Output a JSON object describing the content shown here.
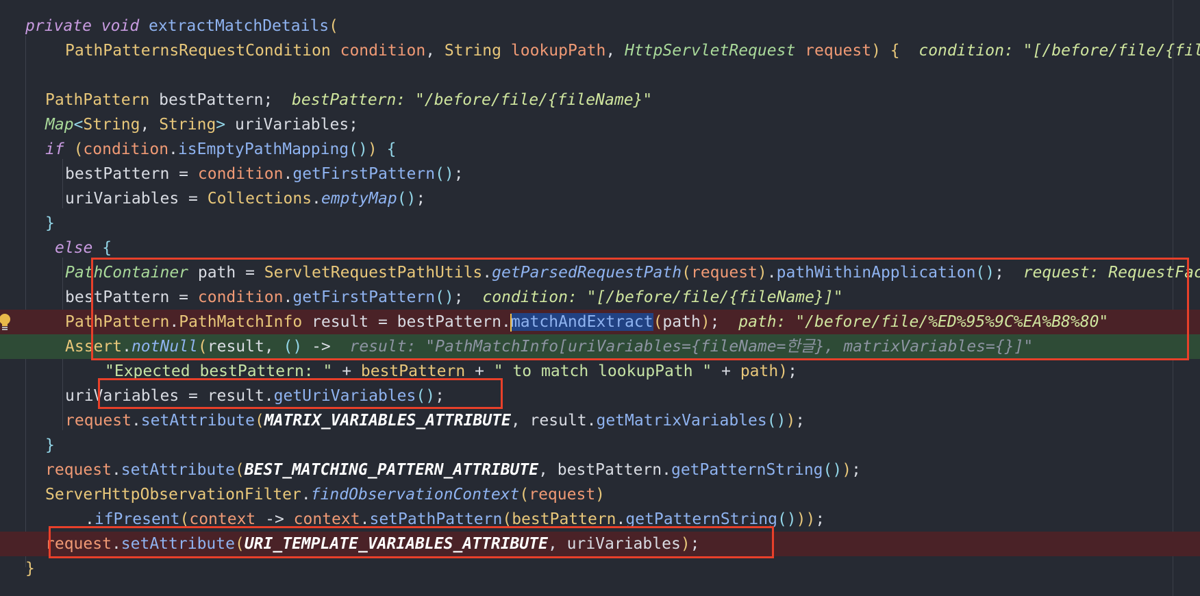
{
  "lines": [
    {
      "id": "method-signature-line",
      "indent": 0,
      "bg": "",
      "tokens": [
        {
          "c": "kw",
          "t": "private"
        },
        {
          "c": "plain",
          "t": " "
        },
        {
          "c": "kw",
          "t": "void"
        },
        {
          "c": "plain",
          "t": " "
        },
        {
          "c": "fn",
          "t": "extractMatchDetails"
        },
        {
          "c": "type",
          "t": "("
        }
      ]
    },
    {
      "id": "method-params-line",
      "indent": 4,
      "bg": "",
      "tokens": [
        {
          "c": "type",
          "t": "PathPatternsRequestCondition"
        },
        {
          "c": "plain",
          "t": " "
        },
        {
          "c": "param",
          "t": "condition"
        },
        {
          "c": "plain",
          "t": ", "
        },
        {
          "c": "type",
          "t": "String"
        },
        {
          "c": "plain",
          "t": " "
        },
        {
          "c": "param",
          "t": "lookupPath"
        },
        {
          "c": "plain",
          "t": ", "
        },
        {
          "c": "type-it",
          "t": "HttpServletRequest"
        },
        {
          "c": "plain",
          "t": " "
        },
        {
          "c": "param",
          "t": "request"
        },
        {
          "c": "type",
          "t": ") {"
        },
        {
          "c": "plain",
          "t": "  "
        },
        {
          "c": "hint",
          "t": "condition: \"[/before/file/{fileName}]\""
        }
      ]
    },
    {
      "id": "blank-line",
      "indent": 0,
      "bg": "",
      "tokens": []
    },
    {
      "id": "best-pattern-decl-line",
      "indent": 2,
      "bg": "",
      "tokens": [
        {
          "c": "type",
          "t": "PathPattern"
        },
        {
          "c": "plain",
          "t": " bestPattern;"
        },
        {
          "c": "plain",
          "t": "  "
        },
        {
          "c": "hint",
          "t": "bestPattern: \"/before/file/{fileName}\""
        }
      ]
    },
    {
      "id": "uri-variables-decl-line",
      "indent": 2,
      "bg": "",
      "tokens": [
        {
          "c": "type-it",
          "t": "Map"
        },
        {
          "c": "punct",
          "t": "<"
        },
        {
          "c": "type",
          "t": "String"
        },
        {
          "c": "plain",
          "t": ", "
        },
        {
          "c": "type",
          "t": "String"
        },
        {
          "c": "punct",
          "t": ">"
        },
        {
          "c": "plain",
          "t": " uriVariables;"
        }
      ]
    },
    {
      "id": "if-line",
      "indent": 2,
      "bg": "",
      "tokens": [
        {
          "c": "kw",
          "t": "if"
        },
        {
          "c": "plain",
          "t": " "
        },
        {
          "c": "type",
          "t": "("
        },
        {
          "c": "param",
          "t": "condition"
        },
        {
          "c": "plain",
          "t": "."
        },
        {
          "c": "fn",
          "t": "isEmptyPathMapping"
        },
        {
          "c": "punct",
          "t": "()"
        },
        {
          "c": "type",
          "t": ")"
        },
        {
          "c": "plain",
          "t": " "
        },
        {
          "c": "punct",
          "t": "{"
        }
      ]
    },
    {
      "id": "if-best-pattern-line",
      "indent": 4,
      "bg": "",
      "tokens": [
        {
          "c": "plain",
          "t": "bestPattern = "
        },
        {
          "c": "param",
          "t": "condition"
        },
        {
          "c": "plain",
          "t": "."
        },
        {
          "c": "fn",
          "t": "getFirstPattern"
        },
        {
          "c": "punct",
          "t": "()"
        },
        {
          "c": "plain",
          "t": ";"
        }
      ]
    },
    {
      "id": "if-uri-variables-line",
      "indent": 4,
      "bg": "",
      "tokens": [
        {
          "c": "plain",
          "t": "uriVariables = "
        },
        {
          "c": "type",
          "t": "Collections"
        },
        {
          "c": "plain",
          "t": "."
        },
        {
          "c": "fn-it",
          "t": "emptyMap"
        },
        {
          "c": "punct",
          "t": "()"
        },
        {
          "c": "plain",
          "t": ";"
        }
      ]
    },
    {
      "id": "if-close-line",
      "indent": 2,
      "bg": "",
      "tokens": [
        {
          "c": "punct",
          "t": "}"
        }
      ]
    },
    {
      "id": "else-line",
      "indent": 2,
      "shift": 14,
      "bg": "",
      "tokens": [
        {
          "c": "kw",
          "t": "else"
        },
        {
          "c": "plain",
          "t": " "
        },
        {
          "c": "punct",
          "t": "{"
        }
      ]
    },
    {
      "id": "path-container-line",
      "indent": 4,
      "bg": "",
      "tokens": [
        {
          "c": "type-it",
          "t": "PathContainer"
        },
        {
          "c": "plain",
          "t": " path = "
        },
        {
          "c": "type",
          "t": "ServletRequestPathUtils"
        },
        {
          "c": "plain",
          "t": "."
        },
        {
          "c": "fn-it",
          "t": "getParsedRequestPath"
        },
        {
          "c": "type",
          "t": "("
        },
        {
          "c": "param",
          "t": "request"
        },
        {
          "c": "type",
          "t": ")"
        },
        {
          "c": "plain",
          "t": "."
        },
        {
          "c": "fn",
          "t": "pathWithinApplication"
        },
        {
          "c": "punct",
          "t": "()"
        },
        {
          "c": "plain",
          "t": ";"
        },
        {
          "c": "plain",
          "t": "  "
        },
        {
          "c": "hint",
          "t": "request: RequestFacade"
        }
      ]
    },
    {
      "id": "else-best-pattern-line",
      "indent": 4,
      "bg": "",
      "tokens": [
        {
          "c": "plain",
          "t": "bestPattern = "
        },
        {
          "c": "param",
          "t": "condition"
        },
        {
          "c": "plain",
          "t": "."
        },
        {
          "c": "fn",
          "t": "getFirstPattern"
        },
        {
          "c": "punct",
          "t": "()"
        },
        {
          "c": "plain",
          "t": ";"
        },
        {
          "c": "plain",
          "t": "  "
        },
        {
          "c": "hint",
          "t": "condition: \"[/before/file/{fileName}]\""
        }
      ]
    },
    {
      "id": "match-and-extract-line",
      "indent": 4,
      "bg": "bp-red",
      "tokens": [
        {
          "c": "type",
          "t": "PathPattern"
        },
        {
          "c": "plain",
          "t": "."
        },
        {
          "c": "type",
          "t": "PathMatchInfo"
        },
        {
          "c": "plain",
          "t": " result = bestPattern."
        },
        {
          "c": "caret",
          "t": ""
        },
        {
          "c": "fn sel",
          "t": "matchAndExtract"
        },
        {
          "c": "type",
          "t": "("
        },
        {
          "c": "plain",
          "t": "path"
        },
        {
          "c": "type",
          "t": ")"
        },
        {
          "c": "plain",
          "t": ";"
        },
        {
          "c": "plain",
          "t": "  "
        },
        {
          "c": "hint",
          "t": "path: \"/before/file/%ED%95%9C%EA%B8%80\""
        }
      ]
    },
    {
      "id": "assert-line",
      "indent": 4,
      "bg": "exec-green",
      "tokens": [
        {
          "c": "type",
          "t": "Assert"
        },
        {
          "c": "plain",
          "t": "."
        },
        {
          "c": "fn-it",
          "t": "notNull"
        },
        {
          "c": "type",
          "t": "("
        },
        {
          "c": "plain",
          "t": "result, "
        },
        {
          "c": "punct",
          "t": "()"
        },
        {
          "c": "plain",
          "t": " ->  "
        },
        {
          "c": "hint-dim",
          "t": "result: \"PathMatchInfo[uriVariables={fileName=한글}, matrixVariables={}]\""
        }
      ]
    },
    {
      "id": "assert-message-line",
      "indent": 8,
      "bg": "",
      "tokens": [
        {
          "c": "str",
          "t": "\"Expected bestPattern: \""
        },
        {
          "c": "plain",
          "t": " + "
        },
        {
          "c": "type",
          "t": "bestPattern"
        },
        {
          "c": "plain",
          "t": " + "
        },
        {
          "c": "str",
          "t": "\" to match lookupPath \""
        },
        {
          "c": "plain",
          "t": " + "
        },
        {
          "c": "type",
          "t": "path"
        },
        {
          "c": "type",
          "t": ")"
        },
        {
          "c": "plain",
          "t": ";"
        }
      ]
    },
    {
      "id": "get-uri-variables-line",
      "indent": 4,
      "bg": "",
      "tokens": [
        {
          "c": "plain",
          "t": "uriVariables = result."
        },
        {
          "c": "fn",
          "t": "getUriVariables"
        },
        {
          "c": "punct",
          "t": "()"
        },
        {
          "c": "plain",
          "t": ";"
        }
      ]
    },
    {
      "id": "matrix-attribute-line",
      "indent": 4,
      "bg": "",
      "tokens": [
        {
          "c": "param",
          "t": "request"
        },
        {
          "c": "plain",
          "t": "."
        },
        {
          "c": "fn",
          "t": "setAttribute"
        },
        {
          "c": "type",
          "t": "("
        },
        {
          "c": "const",
          "t": "MATRIX_VARIABLES_ATTRIBUTE"
        },
        {
          "c": "plain",
          "t": ", result."
        },
        {
          "c": "fn",
          "t": "getMatrixVariables"
        },
        {
          "c": "punct",
          "t": "()"
        },
        {
          "c": "type",
          "t": ")"
        },
        {
          "c": "plain",
          "t": ";"
        }
      ]
    },
    {
      "id": "else-close-line",
      "indent": 2,
      "bg": "",
      "tokens": [
        {
          "c": "punct",
          "t": "}"
        }
      ]
    },
    {
      "id": "best-matching-attribute-line",
      "indent": 2,
      "bg": "",
      "tokens": [
        {
          "c": "param",
          "t": "request"
        },
        {
          "c": "plain",
          "t": "."
        },
        {
          "c": "fn",
          "t": "setAttribute"
        },
        {
          "c": "type",
          "t": "("
        },
        {
          "c": "const",
          "t": "BEST_MATCHING_PATTERN_ATTRIBUTE"
        },
        {
          "c": "plain",
          "t": ", bestPattern."
        },
        {
          "c": "fn",
          "t": "getPatternString"
        },
        {
          "c": "punct",
          "t": "()"
        },
        {
          "c": "type",
          "t": ")"
        },
        {
          "c": "plain",
          "t": ";"
        }
      ]
    },
    {
      "id": "observation-filter-line",
      "indent": 2,
      "bg": "",
      "tokens": [
        {
          "c": "type",
          "t": "ServerHttpObservationFilter"
        },
        {
          "c": "plain",
          "t": "."
        },
        {
          "c": "fn-it",
          "t": "findObservationContext"
        },
        {
          "c": "type",
          "t": "("
        },
        {
          "c": "param",
          "t": "request"
        },
        {
          "c": "type",
          "t": ")"
        }
      ]
    },
    {
      "id": "if-present-line",
      "indent": 6,
      "bg": "",
      "tokens": [
        {
          "c": "plain",
          "t": "."
        },
        {
          "c": "fn",
          "t": "ifPresent"
        },
        {
          "c": "type",
          "t": "("
        },
        {
          "c": "param",
          "t": "context"
        },
        {
          "c": "plain",
          "t": " -> "
        },
        {
          "c": "param",
          "t": "context"
        },
        {
          "c": "plain",
          "t": "."
        },
        {
          "c": "fn",
          "t": "setPathPattern"
        },
        {
          "c": "type",
          "t": "("
        },
        {
          "c": "type",
          "t": "bestPattern"
        },
        {
          "c": "plain",
          "t": "."
        },
        {
          "c": "fn",
          "t": "getPatternString"
        },
        {
          "c": "punct",
          "t": "()"
        },
        {
          "c": "type",
          "t": "))"
        },
        {
          "c": "plain",
          "t": ";"
        }
      ]
    },
    {
      "id": "uri-template-attribute-line",
      "indent": 2,
      "bg": "bp-red",
      "tokens": [
        {
          "c": "param",
          "t": "request"
        },
        {
          "c": "plain",
          "t": "."
        },
        {
          "c": "fn",
          "t": "setAttribute"
        },
        {
          "c": "type",
          "t": "("
        },
        {
          "c": "const",
          "t": "URI_TEMPLATE_VARIABLES_ATTRIBUTE"
        },
        {
          "c": "plain",
          "t": ", uriVariables"
        },
        {
          "c": "type",
          "t": ")"
        },
        {
          "c": "plain",
          "t": ";"
        }
      ]
    },
    {
      "id": "method-close-line",
      "indent": 0,
      "bg": "",
      "tokens": [
        {
          "c": "type",
          "t": "}"
        }
      ]
    }
  ],
  "colors": {
    "editor_background": "#262a33",
    "breakpoint_line": "#4a2227",
    "execution_line": "#2e4b36",
    "annotation_box": "#e8402a"
  }
}
